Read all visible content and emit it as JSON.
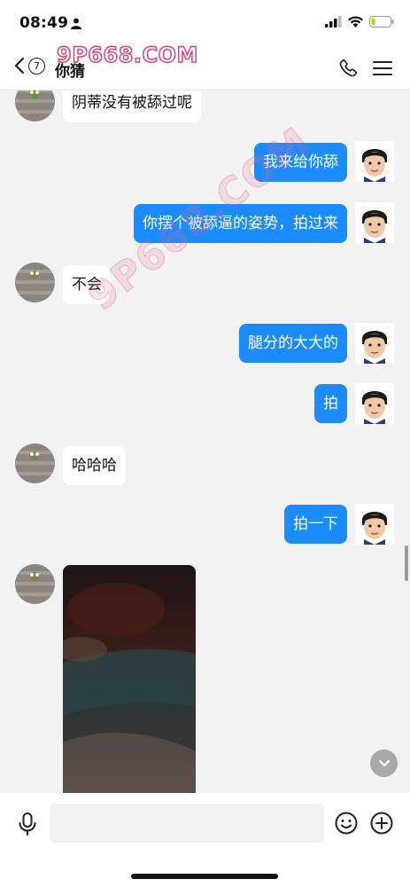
{
  "status": {
    "time": "08:49"
  },
  "watermark": "9P668.COM",
  "watermark_diag": "9P668.COM",
  "nav": {
    "badge": "7",
    "title": "你猜"
  },
  "messages": [
    {
      "side": "in",
      "text": "阴蒂没有被舔过呢"
    },
    {
      "side": "out",
      "text": "我来给你舔"
    },
    {
      "side": "out",
      "text": "你摆个被舔逼的姿势，拍过来"
    },
    {
      "side": "in",
      "text": "不会"
    },
    {
      "side": "out",
      "text": "腿分的大大的"
    },
    {
      "side": "out",
      "text": "拍"
    },
    {
      "side": "in",
      "text": "哈哈哈"
    },
    {
      "side": "out",
      "text": "拍一下"
    }
  ],
  "colors": {
    "outgoing_bubble": "#1a8cff",
    "incoming_bubble": "#ffffff",
    "background": "#f2f2f2"
  }
}
